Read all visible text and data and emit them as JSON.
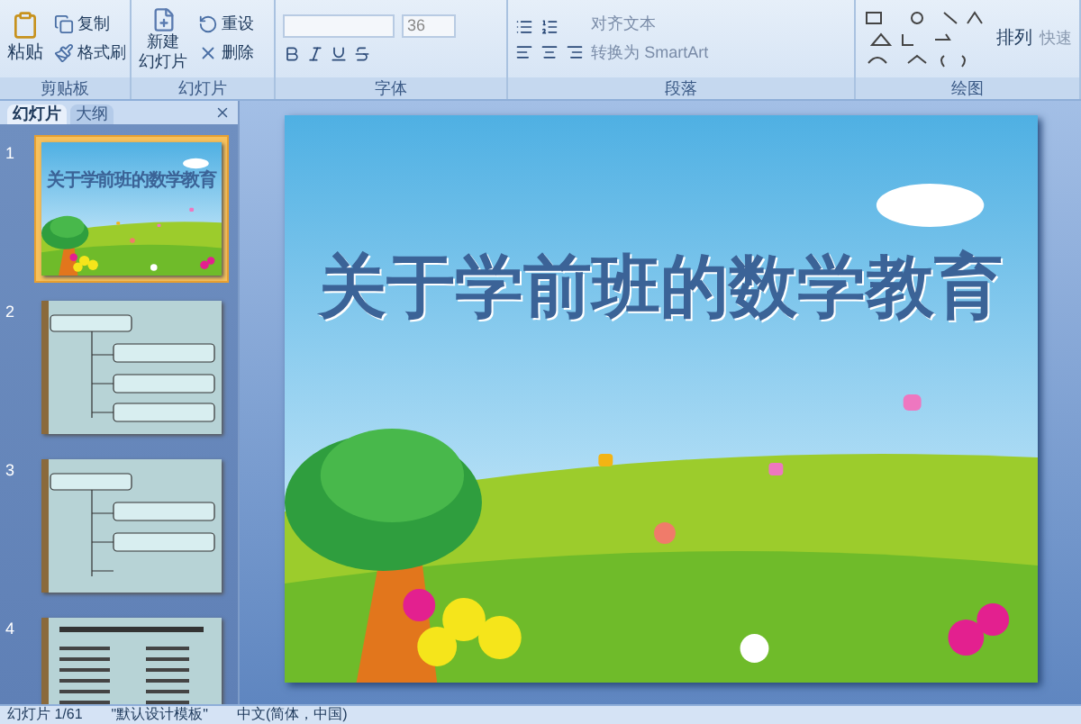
{
  "ribbon": {
    "clipboard": {
      "paste": "粘贴",
      "items": [
        "复制",
        "格式刷"
      ],
      "label": "剪贴板"
    },
    "slides": {
      "new_slide": [
        "新建",
        "幻灯片"
      ],
      "items": [
        "重设",
        "删除"
      ],
      "label": "幻灯片"
    },
    "font": {
      "size": "36",
      "label": "字体"
    },
    "paragraph": {
      "items": [
        "对齐文本",
        "转换为 SmartArt"
      ],
      "label": "段落"
    },
    "drawing": {
      "arrange": "排列",
      "quick": "快速",
      "label": "绘图"
    }
  },
  "panel": {
    "tabs": [
      {
        "label": "幻灯片",
        "selected": true
      },
      {
        "label": "大纲",
        "selected": false
      }
    ],
    "thumbnails": [
      {
        "number": "1",
        "kind": "title",
        "title": "关于学前班的数学教育",
        "selected": true
      },
      {
        "number": "2",
        "kind": "outline",
        "selected": false
      },
      {
        "number": "3",
        "kind": "outline",
        "selected": false
      },
      {
        "number": "4",
        "kind": "list",
        "selected": false
      }
    ]
  },
  "slide": {
    "title": "关于学前班的数学教育"
  },
  "status_bar": [
    "幻灯片 1/61",
    "\"默认设计模板\"",
    "中文(简体，中国)"
  ]
}
